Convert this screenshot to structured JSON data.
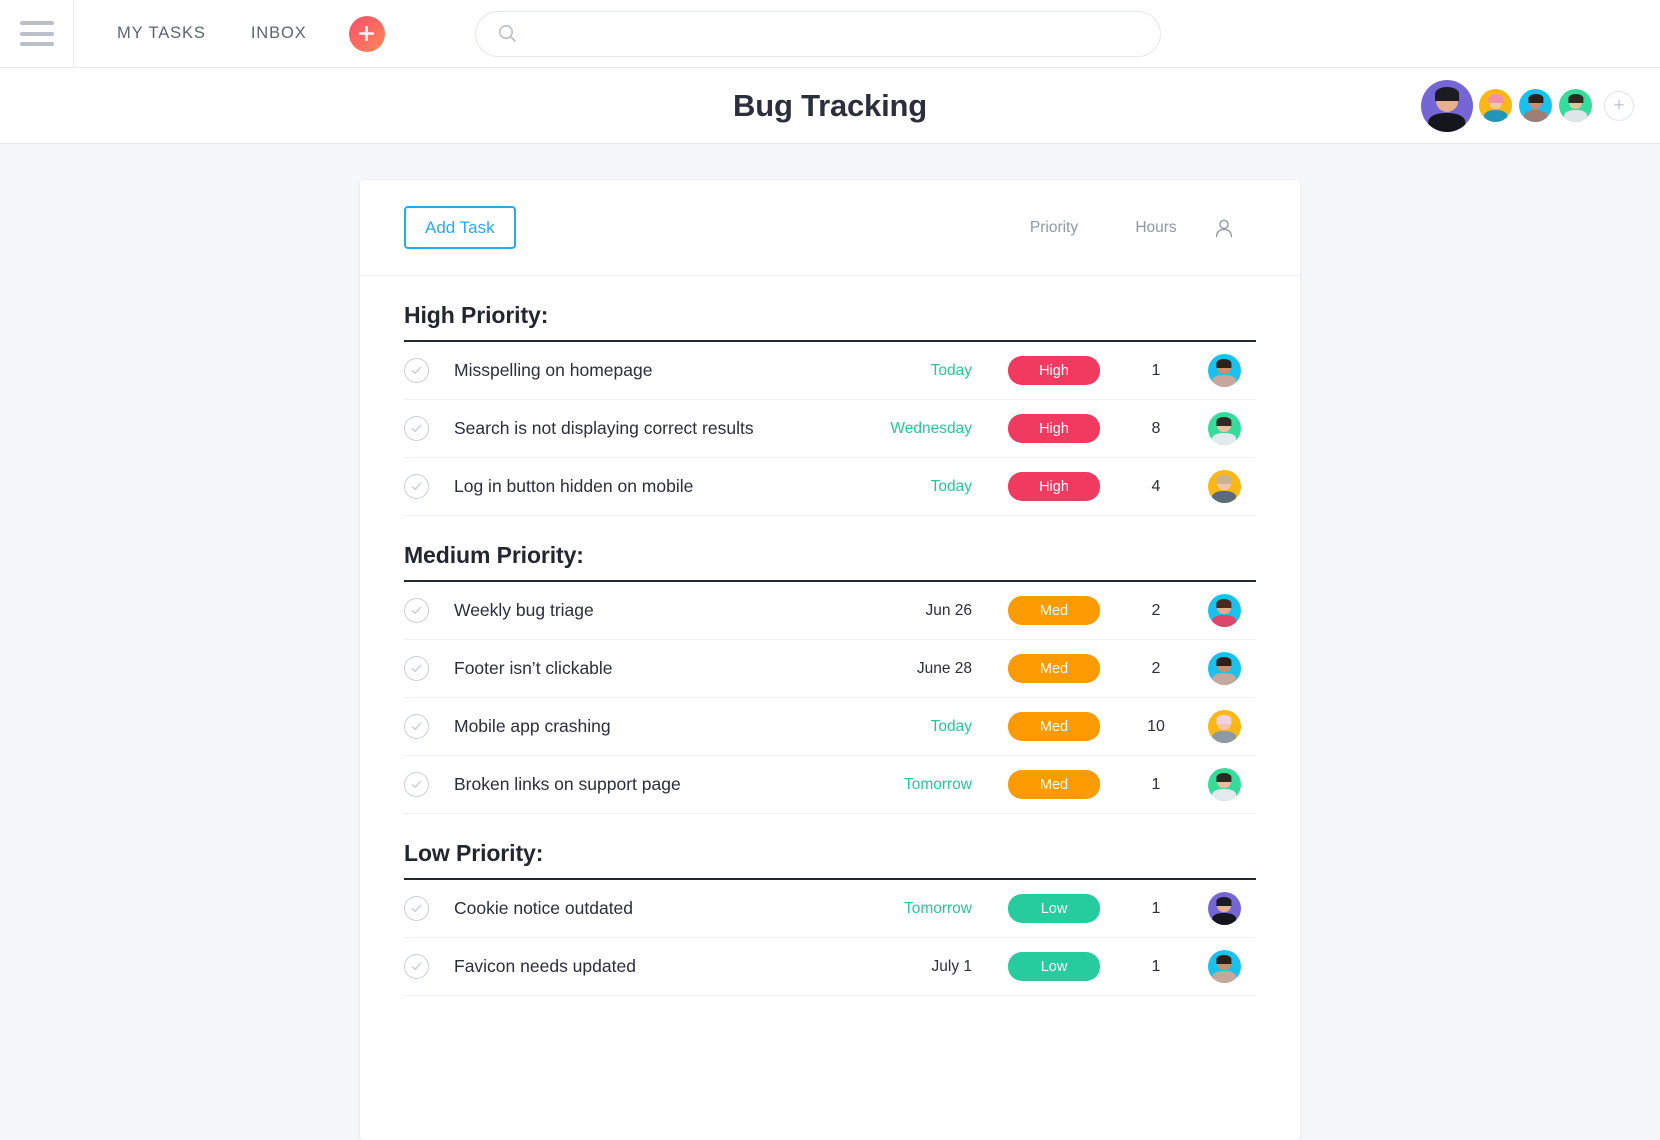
{
  "topbar": {
    "menu_icon": "hamburger-icon",
    "links": [
      {
        "label": "MY TASKS"
      },
      {
        "label": "INBOX"
      }
    ],
    "add_button_icon": "plus-icon",
    "search": {
      "value": "",
      "placeholder": "",
      "icon": "search-icon"
    }
  },
  "header": {
    "title": "Bug Tracking",
    "members": [
      {
        "name": "member-avatar-1",
        "ring": "#7566d6",
        "skin": "#e8b08c",
        "hair": "#1b1b22",
        "shirt": "#15161c"
      },
      {
        "name": "member-avatar-2",
        "ring": "#fbb713",
        "skin": "#f2c6ac",
        "hair": "#f58fa8",
        "shirt": "#2196b8"
      },
      {
        "name": "member-avatar-3",
        "ring": "#19c2ee",
        "skin": "#c98f6e",
        "hair": "#2b2119",
        "shirt": "#9e7f76"
      },
      {
        "name": "member-avatar-4",
        "ring": "#35dd9a",
        "skin": "#edbfa0",
        "hair": "#2d2a23",
        "shirt": "#dfe5e8"
      }
    ],
    "add_member_label": "+"
  },
  "toolbar": {
    "add_task_label": "Add Task",
    "columns": {
      "priority": "Priority",
      "hours": "Hours",
      "assignee_icon": "person-icon"
    }
  },
  "colors": {
    "high": "#f13a5f",
    "med": "#fb9a01",
    "low": "#26cc9e",
    "accent": "#2aa9ef",
    "date_soon": "#24c79a"
  },
  "groups": [
    {
      "title": "High Priority:",
      "tasks": [
        {
          "name": "Misspelling on homepage",
          "date": "Today",
          "date_soon": true,
          "priority": "High",
          "priority_class": "high",
          "hours": "1",
          "avatar": {
            "ring": "#19c2ee",
            "skin": "#c98f6e",
            "hair": "#2b2119",
            "shirt": "#c6a79b"
          }
        },
        {
          "name": "Search is not displaying correct results",
          "date": "Wednesday",
          "date_soon": true,
          "priority": "High",
          "priority_class": "high",
          "hours": "8",
          "avatar": {
            "ring": "#35dd9a",
            "skin": "#edbfa0",
            "hair": "#2d2a23",
            "shirt": "#e3e9ec"
          }
        },
        {
          "name": "Log in button hidden on mobile",
          "date": "Today",
          "date_soon": true,
          "priority": "High",
          "priority_class": "high",
          "hours": "4",
          "avatar": {
            "ring": "#fbb713",
            "skin": "#f2c6ac",
            "hair": "#c9b393",
            "shirt": "#5b6b7a"
          }
        }
      ]
    },
    {
      "title": "Medium Priority:",
      "tasks": [
        {
          "name": "Weekly bug triage",
          "date": "Jun 26",
          "date_soon": false,
          "priority": "Med",
          "priority_class": "med",
          "hours": "2",
          "avatar": {
            "ring": "#19c2ee",
            "skin": "#e5ac8c",
            "hair": "#4b2a1c",
            "shirt": "#e0456b"
          }
        },
        {
          "name": "Footer isn’t clickable",
          "date": "June 28",
          "date_soon": false,
          "priority": "Med",
          "priority_class": "med",
          "hours": "2",
          "avatar": {
            "ring": "#19c2ee",
            "skin": "#c98f6e",
            "hair": "#2b2119",
            "shirt": "#c6a79b"
          }
        },
        {
          "name": "Mobile app crashing",
          "date": "Today",
          "date_soon": true,
          "priority": "Med",
          "priority_class": "med",
          "hours": "10",
          "avatar": {
            "ring": "#fbb713",
            "skin": "#f2c6ac",
            "hair": "#f3d2e0",
            "shirt": "#8d9aa6"
          }
        },
        {
          "name": "Broken links on support page",
          "date": "Tomorrow",
          "date_soon": true,
          "priority": "Med",
          "priority_class": "med",
          "hours": "1",
          "avatar": {
            "ring": "#35dd9a",
            "skin": "#edbfa0",
            "hair": "#2d2a23",
            "shirt": "#e3e9ec"
          }
        }
      ]
    },
    {
      "title": "Low Priority:",
      "tasks": [
        {
          "name": "Cookie notice outdated",
          "date": "Tomorrow",
          "date_soon": true,
          "priority": "Low",
          "priority_class": "low",
          "hours": "1",
          "avatar": {
            "ring": "#7566d6",
            "skin": "#e8b08c",
            "hair": "#1b1b22",
            "shirt": "#15161c"
          }
        },
        {
          "name": "Favicon needs updated",
          "date": "July 1",
          "date_soon": false,
          "priority": "Low",
          "priority_class": "low",
          "hours": "1",
          "avatar": {
            "ring": "#19c2ee",
            "skin": "#c98f6e",
            "hair": "#2b2119",
            "shirt": "#c6a79b"
          }
        }
      ]
    }
  ]
}
